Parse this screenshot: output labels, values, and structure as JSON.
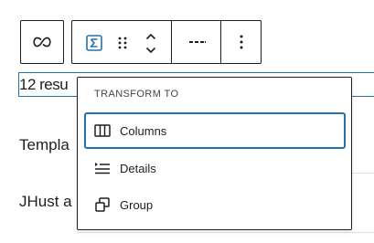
{
  "toolbar": {
    "link_icon": "link-icon",
    "block_icon": "sigma-icon",
    "drag_icon": "drag-handle-icon",
    "move_icon": "move-up-down-icon",
    "more_rich_text_icon": "more-dashes-icon",
    "options_icon": "more-vertical-icon",
    "accent_color": "#2271b1"
  },
  "content": {
    "line1": "12 resu",
    "line2": "Templa",
    "line3": "JHust a"
  },
  "transform_menu": {
    "heading": "TRANSFORM TO",
    "items": [
      {
        "label": "Columns",
        "icon": "columns-icon"
      },
      {
        "label": "Details",
        "icon": "details-icon"
      },
      {
        "label": "Group",
        "icon": "group-icon"
      }
    ]
  }
}
